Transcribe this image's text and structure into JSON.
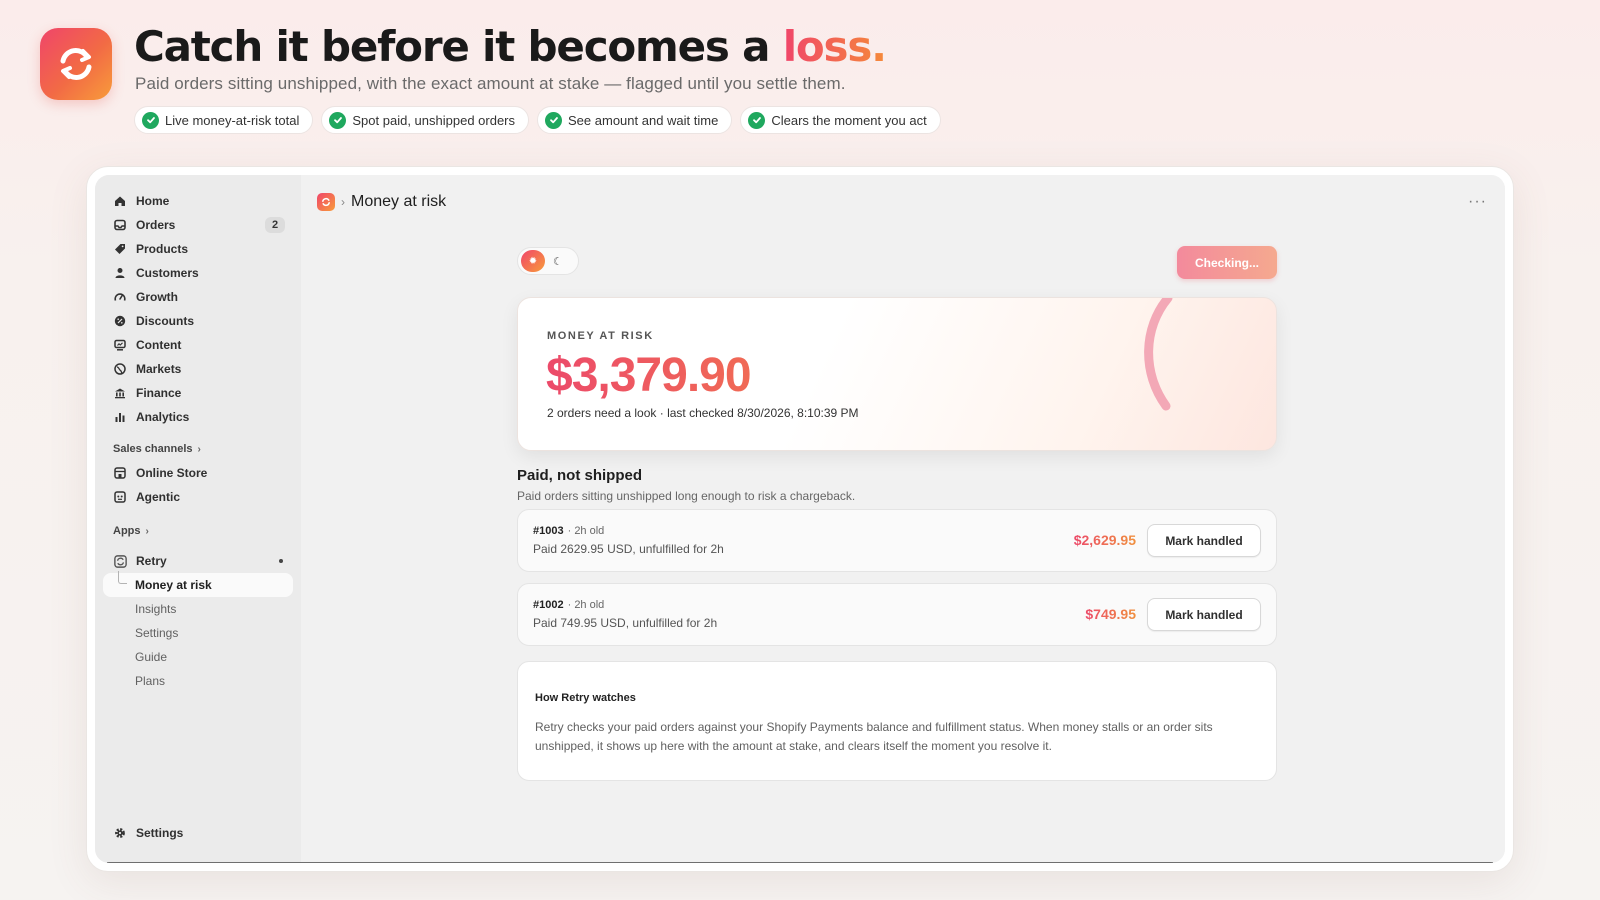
{
  "hero": {
    "title_main": "Catch it before it becomes a ",
    "title_accent": "loss.",
    "subtitle": "Paid orders sitting unshipped, with the exact amount at stake — flagged until you settle them.",
    "features": [
      "Live money-at-risk total",
      "Spot paid, unshipped orders",
      "See amount and wait time",
      "Clears the moment you act"
    ]
  },
  "colors": {
    "brand_start": "#f0456a",
    "brand_end": "#f89c3a",
    "check_green": "#1fa85e"
  },
  "sidebar": {
    "items": [
      {
        "label": "Home",
        "icon": "home-icon"
      },
      {
        "label": "Orders",
        "icon": "orders-icon",
        "badge": "2"
      },
      {
        "label": "Products",
        "icon": "tag-icon"
      },
      {
        "label": "Customers",
        "icon": "person-icon"
      },
      {
        "label": "Growth",
        "icon": "gauge-icon"
      },
      {
        "label": "Discounts",
        "icon": "discount-icon"
      },
      {
        "label": "Content",
        "icon": "content-icon"
      },
      {
        "label": "Markets",
        "icon": "globe-icon"
      },
      {
        "label": "Finance",
        "icon": "bank-icon"
      },
      {
        "label": "Analytics",
        "icon": "bar-chart-icon"
      }
    ],
    "sales_channels_label": "Sales channels",
    "channels": [
      {
        "label": "Online Store",
        "icon": "store-icon"
      },
      {
        "label": "Agentic",
        "icon": "agentic-icon"
      }
    ],
    "apps_label": "Apps",
    "app": {
      "label": "Retry",
      "icon": "retry-app-icon"
    },
    "app_pages": [
      "Money at risk",
      "Insights",
      "Settings",
      "Guide",
      "Plans"
    ],
    "settings_label": "Settings"
  },
  "main": {
    "breadcrumb": "Money at risk",
    "check_button": "Checking...",
    "risk": {
      "label": "MONEY AT RISK",
      "amount": "$3,379.90",
      "meta": "2 orders need a look · last checked 8/30/2026, 8:10:39 PM"
    },
    "section_title": "Paid, not shipped",
    "section_sub": "Paid orders sitting unshipped long enough to risk a chargeback.",
    "orders": [
      {
        "id": "#1003",
        "age": "· 2h old",
        "detail": "Paid 2629.95 USD, unfulfilled for 2h",
        "amount": "$2,629.95",
        "action": "Mark handled"
      },
      {
        "id": "#1002",
        "age": "· 2h old",
        "detail": "Paid 749.95 USD, unfulfilled for 2h",
        "amount": "$749.95",
        "action": "Mark handled"
      }
    ],
    "info": {
      "title": "How Retry watches",
      "body": "Retry checks your paid orders against your Shopify Payments balance and fulfillment status. When money stalls or an order sits unshipped, it shows up here with the amount at stake, and clears itself the moment you resolve it."
    }
  }
}
